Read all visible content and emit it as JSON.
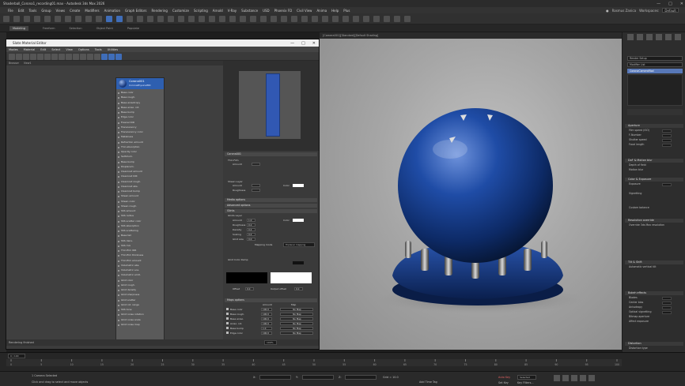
{
  "app": {
    "title": "Shaderball_Corona1_recording01.max - Autodesk 3ds Max 2026",
    "user": "Rasmus Zanica",
    "workspace_label": "Workspaces:",
    "workspace_value": "Default"
  },
  "menubar": [
    "File",
    "Edit",
    "Tools",
    "Group",
    "Views",
    "Create",
    "Modifiers",
    "Animation",
    "Graph Editors",
    "Rendering",
    "Customize",
    "Scripting",
    "Arnold",
    "V-Ray",
    "Substance",
    "USD",
    "Phoenix FD",
    "Civil View",
    "Anima",
    "Help",
    "Plus"
  ],
  "ribbon_tabs": [
    "Modeling",
    "Freeform",
    "Selection",
    "Object Paint",
    "Populate"
  ],
  "viewport": {
    "label": "[Camera001][Standard][Default Shading]"
  },
  "sme": {
    "title": "Slate Material Editor",
    "menu": [
      "Modes",
      "Material",
      "Edit",
      "Select",
      "View",
      "Options",
      "Tools",
      "Utilities"
    ],
    "tabs": [
      "Browser",
      "View1"
    ],
    "node_title": "Corona001",
    "node_subtitle": "CoronaPhysicalMtl",
    "slots": [
      "Base color",
      "Base rough.",
      "Base anisotropy",
      "Base aniso. rot.",
      "Base bump",
      "Edge color",
      "Fresnel IOR",
      "Translucency",
      "Translucency color",
      "Metalness",
      "Refraction amount",
      "Thin absorption",
      "Opacity color",
      "Self-illum.",
      "Base bump",
      "Displacem.",
      "Clearcoat amount",
      "Clearcoat IOR",
      "Clearcoat rough.",
      "Clearcoat abs.",
      "Clearcoat bump",
      "Sheen amount",
      "Sheen color",
      "Sheen rough.",
      "SSS amount",
      "SSS radius",
      "SSS scatter color",
      "SSS absorption",
      "SSS scattering",
      "Base tail",
      "SSS dens.",
      "SSS mix",
      "Thin film IOR",
      "Thin film thickness",
      "Thin film amount",
      "Volumetric abs.",
      "Volumetric sca.",
      "Volumetric emit.",
      "Glint color",
      "Glint rough.",
      "Glint density",
      "Glint sharpness",
      "Glint scatter",
      "Glint rot. range",
      "SSS tone",
      "Glint noise rotation",
      "Glint noise scale",
      "Glint noise map"
    ],
    "status": "Rendering finished",
    "zoom": "100%",
    "params": {
      "rollout_title": "Corona001",
      "thin_film": "Thin Film",
      "sheen_layer": "Sheen Layer",
      "amount": "Amount",
      "color": "Color",
      "roughness": "Roughness",
      "media_options": "Media options",
      "advanced_options": "Advanced options",
      "glints": "Glints",
      "glints_layer": "Glints Layer",
      "density": "Density",
      "scaling": "Scaling",
      "offset": "Offset",
      "glint_size": "Glint size",
      "mapping_mode": "Mapping mode",
      "mapping_value": "Triplanar mapping",
      "glint_color_ramp": "Glint Color Ramp",
      "output_offset": "Output offset",
      "maps_options": "Maps options",
      "maps_header": [
        "Amount",
        "Map"
      ],
      "maps_rows": [
        {
          "label": "Base color",
          "amount": "100.0",
          "map": "No Map"
        },
        {
          "label": "Base rough.",
          "amount": "100.0",
          "map": "No Map"
        },
        {
          "label": "Base aniso.",
          "amount": "100.0",
          "map": "No Map"
        },
        {
          "label": "Aniso. rot.",
          "amount": "100.0",
          "map": "No Map"
        },
        {
          "label": "Base bump",
          "amount": "1.0",
          "map": "No Map"
        },
        {
          "label": "Edge color",
          "amount": "100.0",
          "map": "No Map"
        }
      ],
      "values": {
        "amount": "1.0",
        "roughness": "0.2",
        "density": "0.2",
        "scaling": "0.2",
        "glint_size": "0.0",
        "offset": "0.0",
        "output_offset": "0.0"
      }
    }
  },
  "command_panel": {
    "object_name": "Render Setup",
    "modifier_list": "Modifier List",
    "selected_mod": "CoronaCameraMod",
    "sections": [
      "Aperture",
      "DoF & Motion blur",
      "Color & Exposure",
      "Resolution override",
      "Tilt & Shift",
      "Bokeh effects",
      "Distortion"
    ],
    "rows": {
      "film_speed": "Film speed (ISO)",
      "f_number": "F-Number",
      "shutter_speed": "Shutter speed",
      "focal_length": "Focal length",
      "depth_of_field": "Depth of field",
      "motion_blur": "Motion blur",
      "exposure": "Exposure",
      "vignetting": "Vignetting",
      "custom_balance": "Custom balance",
      "override_res": "Override 3ds Max resolution",
      "auto_vert_tilt": "Automatic vertical tilt",
      "blades": "Blades",
      "center_bias": "Center bias",
      "anisotropy": "Anisotropy",
      "optical_vignetting": "Optical vignetting",
      "bitmap_aperture": "Bitmap aperture",
      "affect_exposure": "Affect exposure",
      "distortion_type": "Distortion type"
    },
    "values": {
      "iso": "100.0",
      "fnum": "16.0",
      "shutter": "50.0",
      "focal": "50.0",
      "blades": "6",
      "center": "0.0",
      "anis": "0.0",
      "optvig": "0.0"
    }
  },
  "timeline": {
    "frame": "0 / 100",
    "ticks": [
      "0",
      "5",
      "10",
      "15",
      "20",
      "25",
      "30",
      "35",
      "40",
      "45",
      "50",
      "55",
      "60",
      "65",
      "70",
      "75",
      "80",
      "85",
      "90",
      "95",
      "100"
    ]
  },
  "statusbar": {
    "selected": "1 Camera Selected",
    "prompt": "Click and drag to select and move objects",
    "x_label": "X:",
    "y_label": "Y:",
    "z_label": "Z:",
    "grid": "Grid = 10.0",
    "add_time_tag": "Add Time Tag",
    "auto_key": "Auto Key",
    "set_key": "Set Key",
    "selected_label": "Selected",
    "key_filters": "Key Filters..."
  }
}
